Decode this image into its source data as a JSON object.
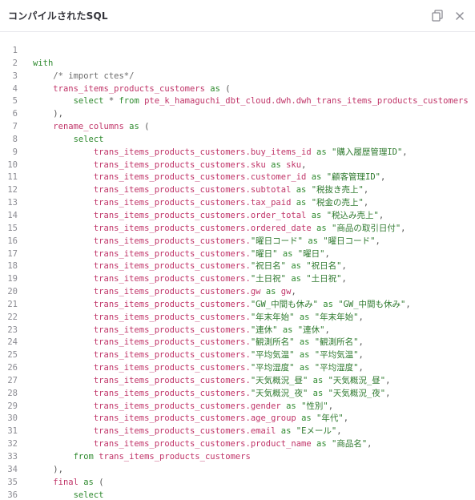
{
  "header": {
    "title": "コンパイルされたSQL",
    "copy_icon": "copy-icon",
    "close_icon": "close-icon"
  },
  "colors": {
    "keyword": "#2f8a2f",
    "identifier": "#c03468",
    "comment": "#6b6b6b",
    "line_number": "#8b8b92"
  },
  "code": {
    "lines": [
      [],
      [
        [
          "kw",
          "with"
        ]
      ],
      [
        [
          "pl",
          "    "
        ],
        [
          "cm",
          "/* import ctes*/"
        ]
      ],
      [
        [
          "pl",
          "    "
        ],
        [
          "id",
          "trans_items_products_customers"
        ],
        [
          "pl",
          " "
        ],
        [
          "kw",
          "as"
        ],
        [
          "pl",
          " ("
        ]
      ],
      [
        [
          "pl",
          "        "
        ],
        [
          "kw",
          "select"
        ],
        [
          "pl",
          " * "
        ],
        [
          "kw",
          "from"
        ],
        [
          "pl",
          " "
        ],
        [
          "id",
          "pte_k_hamaguchi_dbt_cloud.dwh.dwh_trans_items_products_customers"
        ]
      ],
      [
        [
          "pl",
          "    ),"
        ]
      ],
      [
        [
          "pl",
          "    "
        ],
        [
          "id",
          "rename_columns"
        ],
        [
          "pl",
          " "
        ],
        [
          "kw",
          "as"
        ],
        [
          "pl",
          " ("
        ]
      ],
      [
        [
          "pl",
          "        "
        ],
        [
          "kw",
          "select"
        ]
      ],
      [
        [
          "pl",
          "            "
        ],
        [
          "id",
          "trans_items_products_customers.buy_items_id"
        ],
        [
          "pl",
          " "
        ],
        [
          "kw",
          "as"
        ],
        [
          "pl",
          " "
        ],
        [
          "st",
          "\"購入履歴管理ID\""
        ],
        [
          "pl",
          ","
        ]
      ],
      [
        [
          "pl",
          "            "
        ],
        [
          "id",
          "trans_items_products_customers.sku"
        ],
        [
          "pl",
          " "
        ],
        [
          "kw",
          "as"
        ],
        [
          "pl",
          " "
        ],
        [
          "id",
          "sku"
        ],
        [
          "pl",
          ","
        ]
      ],
      [
        [
          "pl",
          "            "
        ],
        [
          "id",
          "trans_items_products_customers.customer_id"
        ],
        [
          "pl",
          " "
        ],
        [
          "kw",
          "as"
        ],
        [
          "pl",
          " "
        ],
        [
          "st",
          "\"顧客管理ID\""
        ],
        [
          "pl",
          ","
        ]
      ],
      [
        [
          "pl",
          "            "
        ],
        [
          "id",
          "trans_items_products_customers.subtotal"
        ],
        [
          "pl",
          " "
        ],
        [
          "kw",
          "as"
        ],
        [
          "pl",
          " "
        ],
        [
          "st",
          "\"税抜き売上\""
        ],
        [
          "pl",
          ","
        ]
      ],
      [
        [
          "pl",
          "            "
        ],
        [
          "id",
          "trans_items_products_customers.tax_paid"
        ],
        [
          "pl",
          " "
        ],
        [
          "kw",
          "as"
        ],
        [
          "pl",
          " "
        ],
        [
          "st",
          "\"税金の売上\""
        ],
        [
          "pl",
          ","
        ]
      ],
      [
        [
          "pl",
          "            "
        ],
        [
          "id",
          "trans_items_products_customers.order_total"
        ],
        [
          "pl",
          " "
        ],
        [
          "kw",
          "as"
        ],
        [
          "pl",
          " "
        ],
        [
          "st",
          "\"税込み売上\""
        ],
        [
          "pl",
          ","
        ]
      ],
      [
        [
          "pl",
          "            "
        ],
        [
          "id",
          "trans_items_products_customers.ordered_date"
        ],
        [
          "pl",
          " "
        ],
        [
          "kw",
          "as"
        ],
        [
          "pl",
          " "
        ],
        [
          "st",
          "\"商品の取引日付\""
        ],
        [
          "pl",
          ","
        ]
      ],
      [
        [
          "pl",
          "            "
        ],
        [
          "id",
          "trans_items_products_customers."
        ],
        [
          "st",
          "\"曜日コード\""
        ],
        [
          "pl",
          " "
        ],
        [
          "kw",
          "as"
        ],
        [
          "pl",
          " "
        ],
        [
          "st",
          "\"曜日コード\""
        ],
        [
          "pl",
          ","
        ]
      ],
      [
        [
          "pl",
          "            "
        ],
        [
          "id",
          "trans_items_products_customers."
        ],
        [
          "st",
          "\"曜日\""
        ],
        [
          "pl",
          " "
        ],
        [
          "kw",
          "as"
        ],
        [
          "pl",
          " "
        ],
        [
          "st",
          "\"曜日\""
        ],
        [
          "pl",
          ","
        ]
      ],
      [
        [
          "pl",
          "            "
        ],
        [
          "id",
          "trans_items_products_customers."
        ],
        [
          "st",
          "\"祝日名\""
        ],
        [
          "pl",
          " "
        ],
        [
          "kw",
          "as"
        ],
        [
          "pl",
          " "
        ],
        [
          "st",
          "\"祝日名\""
        ],
        [
          "pl",
          ","
        ]
      ],
      [
        [
          "pl",
          "            "
        ],
        [
          "id",
          "trans_items_products_customers."
        ],
        [
          "st",
          "\"土日祝\""
        ],
        [
          "pl",
          " "
        ],
        [
          "kw",
          "as"
        ],
        [
          "pl",
          " "
        ],
        [
          "st",
          "\"土日祝\""
        ],
        [
          "pl",
          ","
        ]
      ],
      [
        [
          "pl",
          "            "
        ],
        [
          "id",
          "trans_items_products_customers.gw"
        ],
        [
          "pl",
          " "
        ],
        [
          "kw",
          "as"
        ],
        [
          "pl",
          " "
        ],
        [
          "id",
          "gw"
        ],
        [
          "pl",
          ","
        ]
      ],
      [
        [
          "pl",
          "            "
        ],
        [
          "id",
          "trans_items_products_customers."
        ],
        [
          "st",
          "\"GW_中間も休み\""
        ],
        [
          "pl",
          " "
        ],
        [
          "kw",
          "as"
        ],
        [
          "pl",
          " "
        ],
        [
          "st",
          "\"GW_中間も休み\""
        ],
        [
          "pl",
          ","
        ]
      ],
      [
        [
          "pl",
          "            "
        ],
        [
          "id",
          "trans_items_products_customers."
        ],
        [
          "st",
          "\"年末年始\""
        ],
        [
          "pl",
          " "
        ],
        [
          "kw",
          "as"
        ],
        [
          "pl",
          " "
        ],
        [
          "st",
          "\"年末年始\""
        ],
        [
          "pl",
          ","
        ]
      ],
      [
        [
          "pl",
          "            "
        ],
        [
          "id",
          "trans_items_products_customers."
        ],
        [
          "st",
          "\"連休\""
        ],
        [
          "pl",
          " "
        ],
        [
          "kw",
          "as"
        ],
        [
          "pl",
          " "
        ],
        [
          "st",
          "\"連休\""
        ],
        [
          "pl",
          ","
        ]
      ],
      [
        [
          "pl",
          "            "
        ],
        [
          "id",
          "trans_items_products_customers."
        ],
        [
          "st",
          "\"観測所名\""
        ],
        [
          "pl",
          " "
        ],
        [
          "kw",
          "as"
        ],
        [
          "pl",
          " "
        ],
        [
          "st",
          "\"観測所名\""
        ],
        [
          "pl",
          ","
        ]
      ],
      [
        [
          "pl",
          "            "
        ],
        [
          "id",
          "trans_items_products_customers."
        ],
        [
          "st",
          "\"平均気温\""
        ],
        [
          "pl",
          " "
        ],
        [
          "kw",
          "as"
        ],
        [
          "pl",
          " "
        ],
        [
          "st",
          "\"平均気温\""
        ],
        [
          "pl",
          ","
        ]
      ],
      [
        [
          "pl",
          "            "
        ],
        [
          "id",
          "trans_items_products_customers."
        ],
        [
          "st",
          "\"平均湿度\""
        ],
        [
          "pl",
          " "
        ],
        [
          "kw",
          "as"
        ],
        [
          "pl",
          " "
        ],
        [
          "st",
          "\"平均湿度\""
        ],
        [
          "pl",
          ","
        ]
      ],
      [
        [
          "pl",
          "            "
        ],
        [
          "id",
          "trans_items_products_customers."
        ],
        [
          "st",
          "\"天気概況_昼\""
        ],
        [
          "pl",
          " "
        ],
        [
          "kw",
          "as"
        ],
        [
          "pl",
          " "
        ],
        [
          "st",
          "\"天気概況_昼\""
        ],
        [
          "pl",
          ","
        ]
      ],
      [
        [
          "pl",
          "            "
        ],
        [
          "id",
          "trans_items_products_customers."
        ],
        [
          "st",
          "\"天気概況_夜\""
        ],
        [
          "pl",
          " "
        ],
        [
          "kw",
          "as"
        ],
        [
          "pl",
          " "
        ],
        [
          "st",
          "\"天気概況_夜\""
        ],
        [
          "pl",
          ","
        ]
      ],
      [
        [
          "pl",
          "            "
        ],
        [
          "id",
          "trans_items_products_customers.gender"
        ],
        [
          "pl",
          " "
        ],
        [
          "kw",
          "as"
        ],
        [
          "pl",
          " "
        ],
        [
          "st",
          "\"性別\""
        ],
        [
          "pl",
          ","
        ]
      ],
      [
        [
          "pl",
          "            "
        ],
        [
          "id",
          "trans_items_products_customers.age_group"
        ],
        [
          "pl",
          " "
        ],
        [
          "kw",
          "as"
        ],
        [
          "pl",
          " "
        ],
        [
          "st",
          "\"年代\""
        ],
        [
          "pl",
          ","
        ]
      ],
      [
        [
          "pl",
          "            "
        ],
        [
          "id",
          "trans_items_products_customers.email"
        ],
        [
          "pl",
          " "
        ],
        [
          "kw",
          "as"
        ],
        [
          "pl",
          " "
        ],
        [
          "st",
          "\"Eメール\""
        ],
        [
          "pl",
          ","
        ]
      ],
      [
        [
          "pl",
          "            "
        ],
        [
          "id",
          "trans_items_products_customers.product_name"
        ],
        [
          "pl",
          " "
        ],
        [
          "kw",
          "as"
        ],
        [
          "pl",
          " "
        ],
        [
          "st",
          "\"商品名\""
        ],
        [
          "pl",
          ","
        ]
      ],
      [
        [
          "pl",
          "        "
        ],
        [
          "kw",
          "from"
        ],
        [
          "pl",
          " "
        ],
        [
          "id",
          "trans_items_products_customers"
        ]
      ],
      [
        [
          "pl",
          "    ),"
        ]
      ],
      [
        [
          "pl",
          "    "
        ],
        [
          "id",
          "final"
        ],
        [
          "pl",
          " "
        ],
        [
          "kw",
          "as"
        ],
        [
          "pl",
          " ("
        ]
      ],
      [
        [
          "pl",
          "        "
        ],
        [
          "kw",
          "select"
        ]
      ]
    ]
  }
}
